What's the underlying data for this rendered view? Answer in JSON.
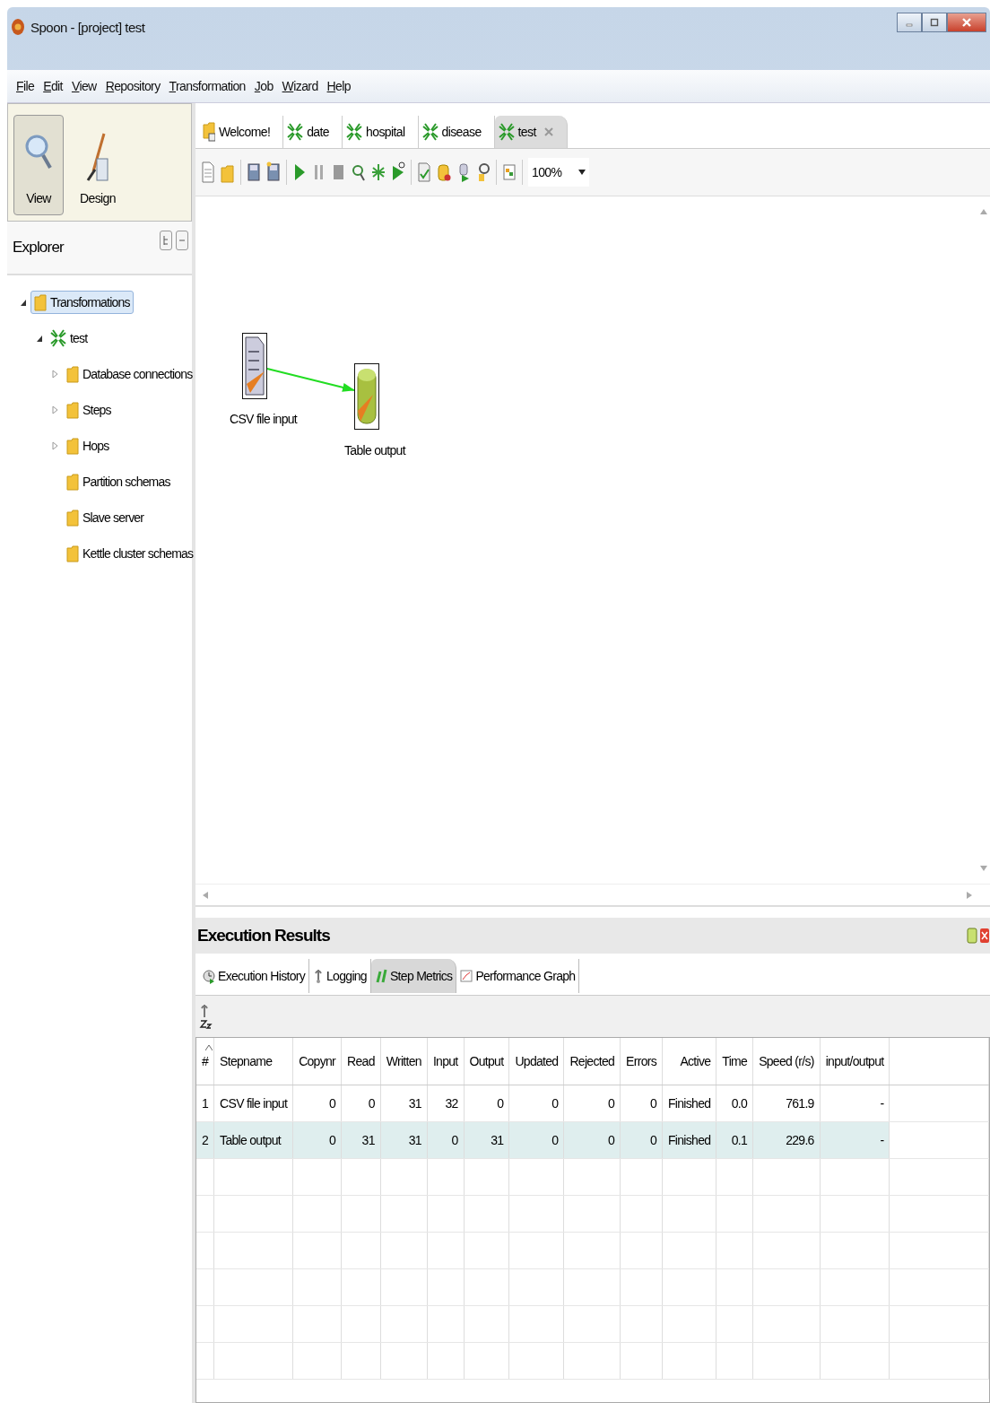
{
  "window": {
    "title": "Spoon - [project] test"
  },
  "menu": [
    "File",
    "Edit",
    "View",
    "Repository",
    "Transformation",
    "Job",
    "Wizard",
    "Help"
  ],
  "perspectives": [
    {
      "label": "View",
      "kind": "view",
      "selected": true
    },
    {
      "label": "Design",
      "kind": "design",
      "selected": false
    }
  ],
  "explorer": {
    "title": "Explorer",
    "tree": [
      {
        "label": "Transformations",
        "kind": "folder",
        "expanded": true,
        "selected": true,
        "children": [
          {
            "label": "test",
            "kind": "transformation",
            "expanded": true,
            "selected": false,
            "children": [
              {
                "label": "Database connections",
                "kind": "folder",
                "expanded": false,
                "selected": false
              },
              {
                "label": "Steps",
                "kind": "folder",
                "expanded": false,
                "selected": false
              },
              {
                "label": "Hops",
                "kind": "folder",
                "expanded": false,
                "selected": false
              },
              {
                "label": "Partition schemas",
                "kind": "folder",
                "selected": false
              },
              {
                "label": "Slave server",
                "kind": "folder",
                "selected": false
              },
              {
                "label": "Kettle cluster schemas",
                "kind": "folder",
                "selected": false
              }
            ]
          }
        ]
      }
    ]
  },
  "tabs": [
    {
      "label": "Welcome!",
      "kind": "welcome",
      "selected": false,
      "closable": false
    },
    {
      "label": "date",
      "kind": "transformation",
      "selected": false,
      "closable": false
    },
    {
      "label": "hospital",
      "kind": "transformation",
      "selected": false,
      "closable": false
    },
    {
      "label": "disease",
      "kind": "transformation",
      "selected": false,
      "closable": false
    },
    {
      "label": "test",
      "kind": "transformation",
      "selected": true,
      "closable": true
    }
  ],
  "zoom": "100%",
  "canvas": {
    "steps": [
      {
        "label": "CSV file input",
        "kind": "csv"
      },
      {
        "label": "Table output",
        "kind": "table"
      }
    ]
  },
  "results": {
    "title": "Execution Results",
    "tabs": [
      {
        "label": "Execution History",
        "kind": "history",
        "selected": false
      },
      {
        "label": "Logging",
        "kind": "logging",
        "selected": false
      },
      {
        "label": "Step Metrics",
        "kind": "metrics",
        "selected": true
      },
      {
        "label": "Performance Graph",
        "kind": "graph",
        "selected": false
      }
    ],
    "columns": [
      {
        "label": "#",
        "sorted": true
      },
      {
        "label": "Stepname",
        "sorted": false
      },
      {
        "label": "Copynr",
        "sorted": false
      },
      {
        "label": "Read",
        "sorted": false
      },
      {
        "label": "Written",
        "sorted": false
      },
      {
        "label": "Input",
        "sorted": false
      },
      {
        "label": "Output",
        "sorted": false
      },
      {
        "label": "Updated",
        "sorted": false
      },
      {
        "label": "Rejected",
        "sorted": false
      },
      {
        "label": "Errors",
        "sorted": false
      },
      {
        "label": "Active",
        "sorted": false
      },
      {
        "label": "Time",
        "sorted": false
      },
      {
        "label": "Speed (r/s)",
        "sorted": false
      },
      {
        "label": "input/output",
        "sorted": false
      }
    ],
    "rows": [
      {
        "selected": false,
        "cells": [
          "1",
          "CSV file input",
          "0",
          "0",
          "31",
          "32",
          "0",
          "0",
          "0",
          "0",
          "Finished",
          "0.0",
          "761.9",
          "-"
        ]
      },
      {
        "selected": true,
        "cells": [
          "2",
          "Table output",
          "0",
          "31",
          "31",
          "0",
          "31",
          "0",
          "0",
          "0",
          "Finished",
          "0.1",
          "229.6",
          "-"
        ]
      }
    ]
  }
}
